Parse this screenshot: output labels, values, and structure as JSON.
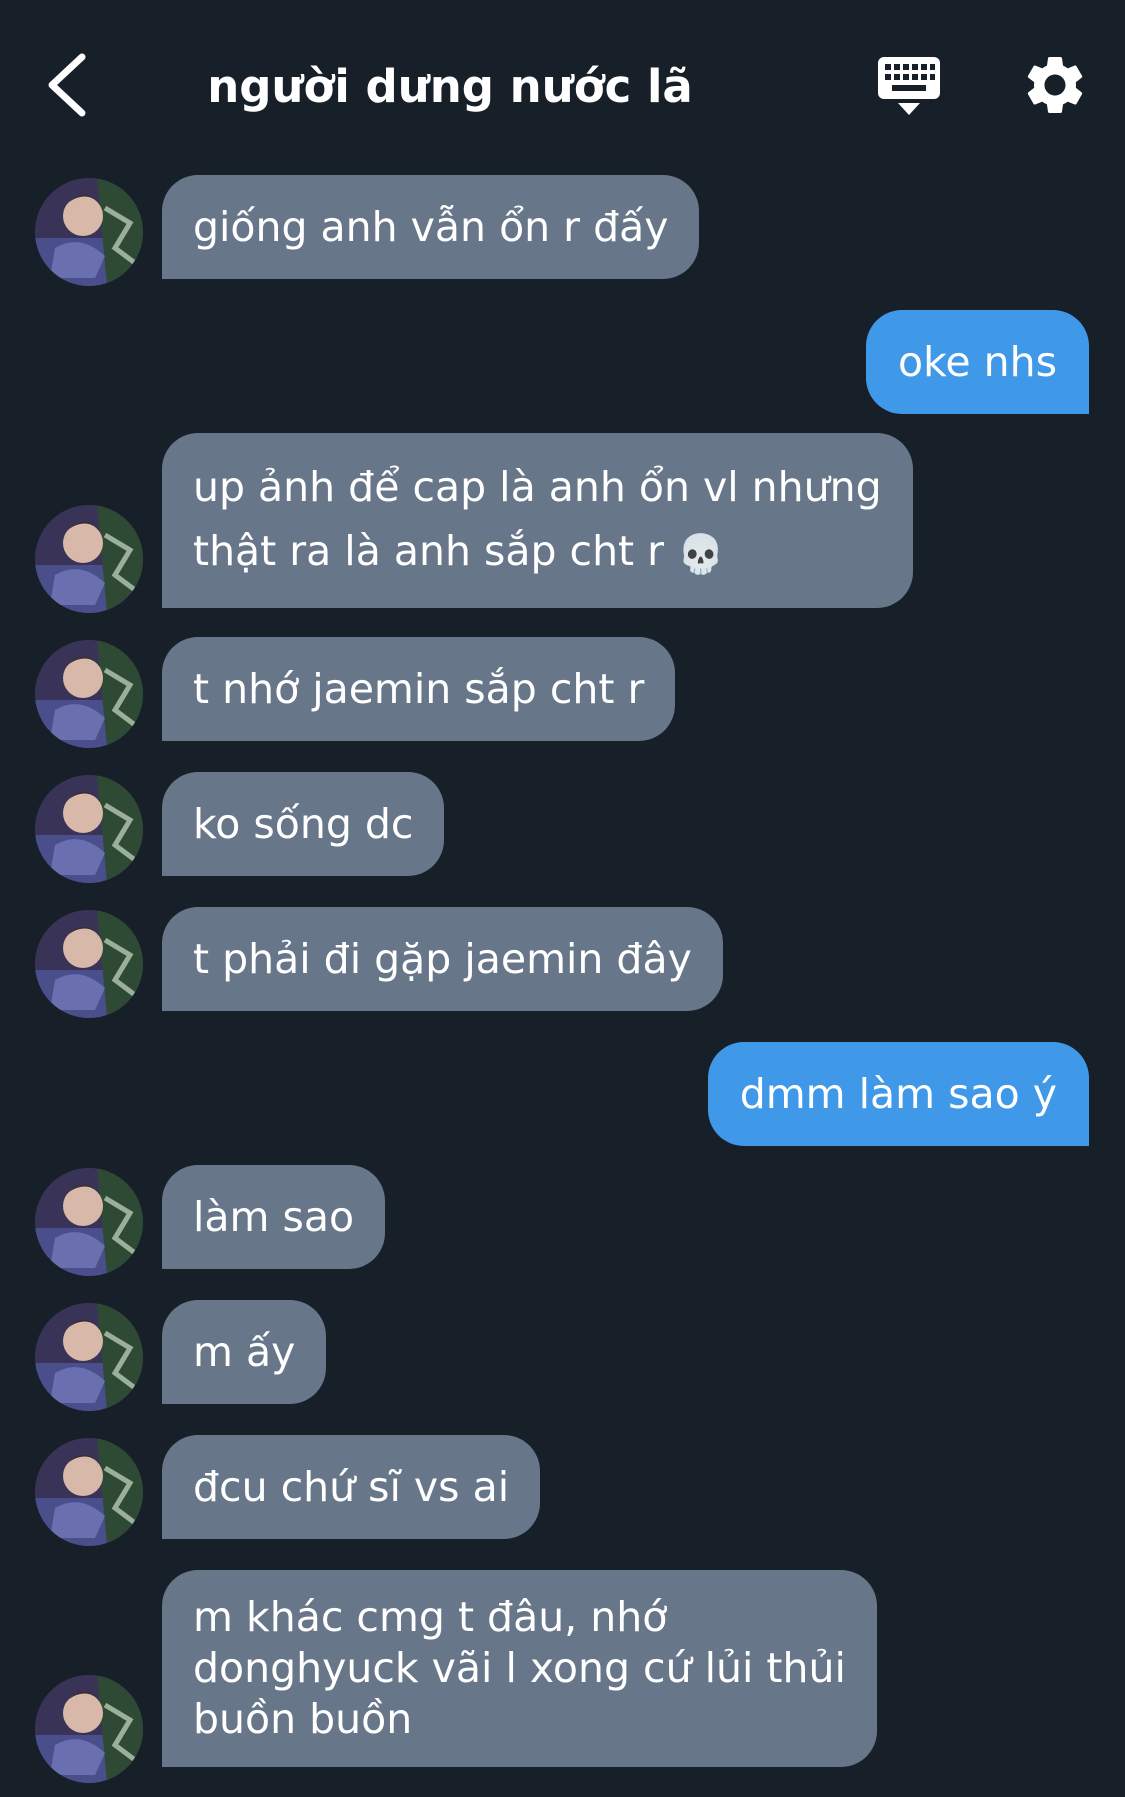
{
  "header": {
    "title": "người dưng nước lã"
  },
  "icons": {
    "back": "chevron-left-icon",
    "keyboard": "keyboard-icon",
    "settings": "gear-icon",
    "skull": "skull-icon"
  },
  "colors": {
    "background": "#172029",
    "incoming_bubble": "#68768a",
    "outgoing_bubble": "#3f98e8",
    "text": "#ffffff"
  },
  "messages": [
    {
      "direction": "in",
      "text": "giống anh vẫn ổn r đấy"
    },
    {
      "direction": "out",
      "text": "oke nhs"
    },
    {
      "direction": "in",
      "lines": [
        "up ảnh để cap là anh ổn vl nhưng",
        "thật ra là anh sắp cht r"
      ],
      "emoji": "💀"
    },
    {
      "direction": "in",
      "text": "t nhớ jaemin sắp cht r"
    },
    {
      "direction": "in",
      "text": "ko sống dc"
    },
    {
      "direction": "in",
      "text": "t phải đi gặp jaemin đây"
    },
    {
      "direction": "out",
      "text": "dmm làm sao ý"
    },
    {
      "direction": "in",
      "text": "làm sao"
    },
    {
      "direction": "in",
      "text": "m ấy"
    },
    {
      "direction": "in",
      "text": "đcu chứ sĩ vs ai"
    },
    {
      "direction": "in",
      "lines": [
        "m khác cmg t đâu, nhớ",
        "donghyuck vãi l xong cứ lủi thủi",
        "buồn buồn"
      ]
    }
  ]
}
